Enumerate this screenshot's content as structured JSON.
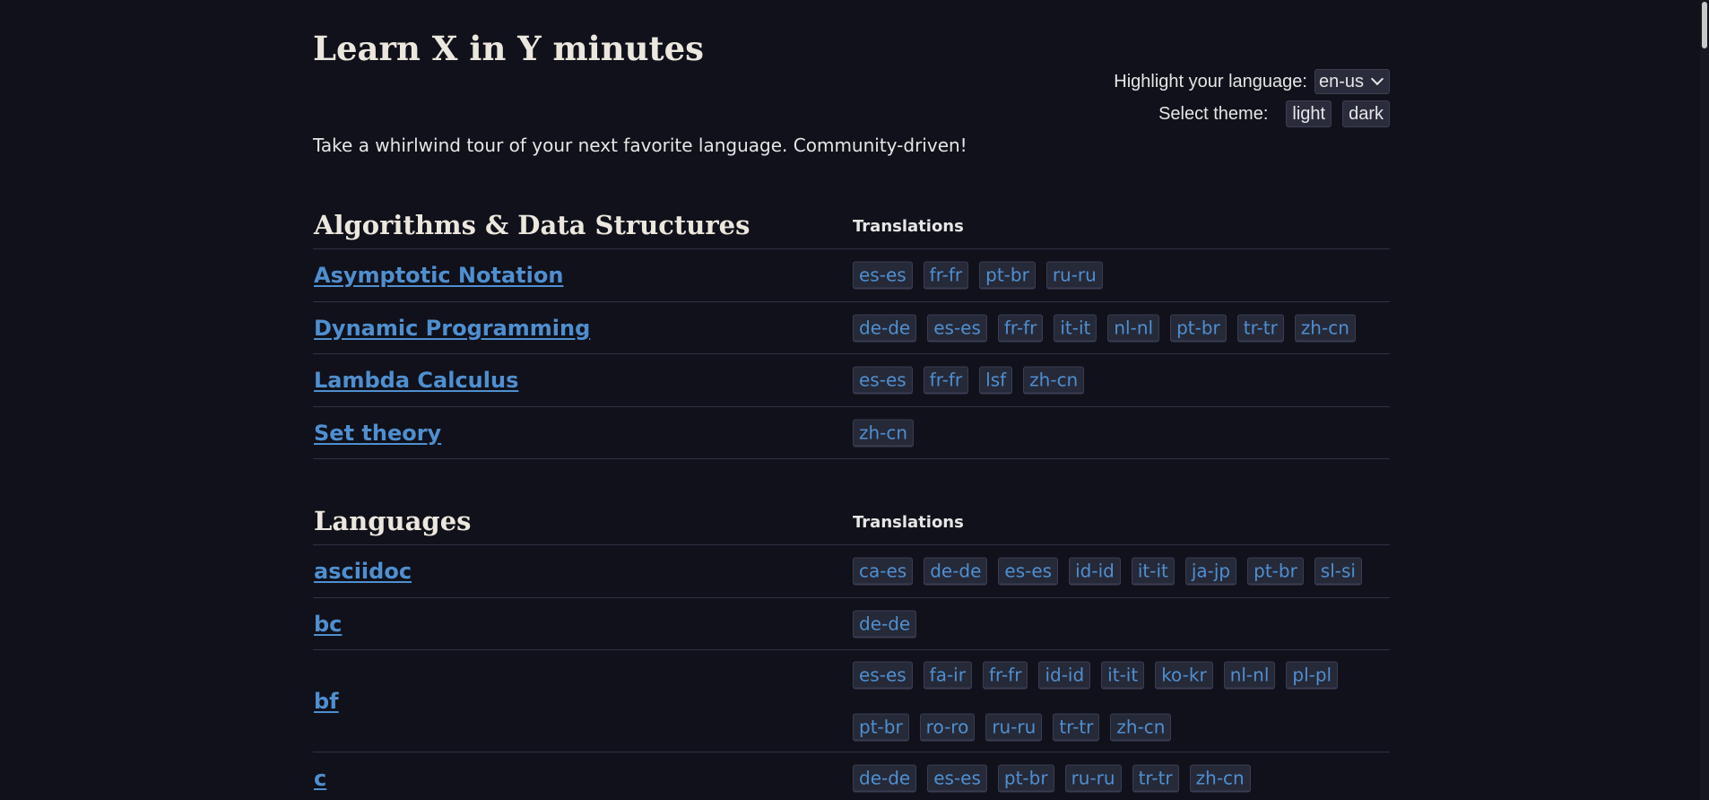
{
  "header": {
    "title": "Learn X in Y minutes",
    "tagline": "Take a whirlwind tour of your next favorite language. Community-driven!"
  },
  "controls": {
    "highlight_label": "Highlight your language:",
    "language_value": "en-us",
    "theme_label": "Select theme:",
    "light_label": "light",
    "dark_label": "dark"
  },
  "sections": [
    {
      "title": "Algorithms & Data Structures",
      "translations_heading": "Translations",
      "rows": [
        {
          "name": "Asymptotic Notation",
          "tags": [
            "es-es",
            "fr-fr",
            "pt-br",
            "ru-ru"
          ]
        },
        {
          "name": "Dynamic Programming",
          "tags": [
            "de-de",
            "es-es",
            "fr-fr",
            "it-it",
            "nl-nl",
            "pt-br",
            "tr-tr",
            "zh-cn"
          ]
        },
        {
          "name": "Lambda Calculus",
          "tags": [
            "es-es",
            "fr-fr",
            "lsf",
            "zh-cn"
          ]
        },
        {
          "name": "Set theory",
          "tags": [
            "zh-cn"
          ]
        }
      ]
    },
    {
      "title": "Languages",
      "translations_heading": "Translations",
      "rows": [
        {
          "name": "asciidoc",
          "tags": [
            "ca-es",
            "de-de",
            "es-es",
            "id-id",
            "it-it",
            "ja-jp",
            "pt-br",
            "sl-si"
          ]
        },
        {
          "name": "bc",
          "tags": [
            "de-de"
          ]
        },
        {
          "name": "bf",
          "tags": [
            "es-es",
            "fa-ir",
            "fr-fr",
            "id-id",
            "it-it",
            "ko-kr",
            "nl-nl",
            "pl-pl",
            "pt-br",
            "ro-ro",
            "ru-ru",
            "tr-tr",
            "zh-cn"
          ]
        },
        {
          "name": "c",
          "tags": [
            "de-de",
            "es-es",
            "pt-br",
            "ru-ru",
            "tr-tr",
            "zh-cn"
          ]
        }
      ]
    }
  ]
}
